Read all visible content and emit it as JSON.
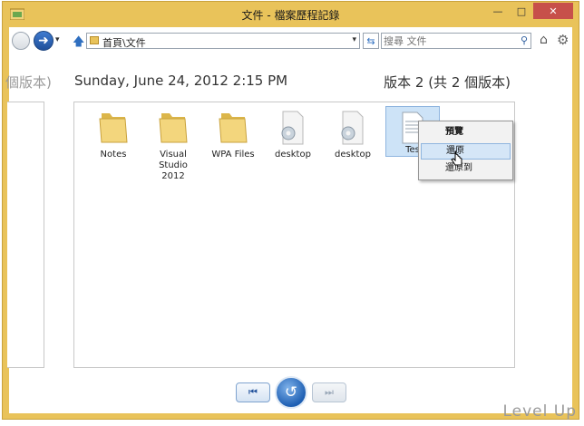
{
  "window": {
    "title": "文件 - 檔案歷程記錄",
    "minimize": "—",
    "maximize": "□",
    "close": "✕"
  },
  "toolbar": {
    "back_icon": "",
    "forward_icon": "➜",
    "dropdown": "▾",
    "up_icon": "🡅",
    "address": "首頁\\文件",
    "address_dropdown": "▾",
    "refresh_icon": "⇆",
    "search_placeholder": "搜尋 文件",
    "search_icon": "⚲",
    "home_icon": "⌂",
    "settings_icon": "⚙"
  },
  "header": {
    "prev_label": "個版本)",
    "date": "Sunday, June 24, 2012 2:15 PM",
    "version": "版本 2 (共 2 個版本)"
  },
  "files": [
    {
      "name": "Notes",
      "type": "folder"
    },
    {
      "name": "Visual Studio 2012",
      "type": "folder"
    },
    {
      "name": "WPA Files",
      "type": "folder"
    },
    {
      "name": "desktop",
      "type": "settings"
    },
    {
      "name": "desktop",
      "type": "settings"
    },
    {
      "name": "Tes",
      "type": "text",
      "selected": true
    }
  ],
  "context_menu": {
    "preview": "預覽",
    "restore": "還原",
    "restore_to": "還原到"
  },
  "bottom_nav": {
    "prev_icon": "⏮",
    "restore_icon": "↺",
    "next_icon": "⏭"
  },
  "watermark": "Level Up",
  "colors": {
    "window_frame": "#e9c35a",
    "close_button": "#c7504a",
    "selection": "#cde3f7",
    "accent_blue": "#1e5fb3"
  }
}
